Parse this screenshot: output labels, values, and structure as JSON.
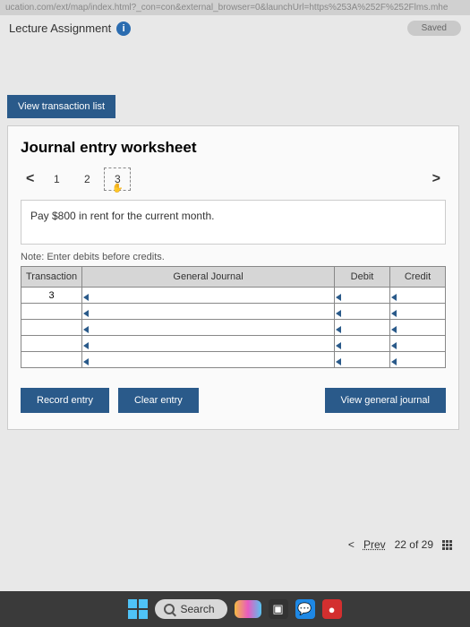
{
  "url": "ucation.com/ext/map/index.html?_con=con&external_browser=0&launchUrl=https%253A%252F%252Flms.mhe",
  "header": {
    "title": "Lecture Assignment",
    "saved_label": "Saved"
  },
  "view_transaction_btn": "View transaction list",
  "worksheet": {
    "title": "Journal entry worksheet",
    "pages": [
      "1",
      "2",
      "3"
    ],
    "current_page_index": 2,
    "instruction": "Pay $800 in rent for the current month.",
    "note": "Note: Enter debits before credits.",
    "columns": {
      "transaction": "Transaction",
      "general_journal": "General Journal",
      "debit": "Debit",
      "credit": "Credit"
    },
    "rows": [
      {
        "transaction": "3",
        "gj": "",
        "debit": "",
        "credit": ""
      },
      {
        "transaction": "",
        "gj": "",
        "debit": "",
        "credit": ""
      },
      {
        "transaction": "",
        "gj": "",
        "debit": "",
        "credit": ""
      },
      {
        "transaction": "",
        "gj": "",
        "debit": "",
        "credit": ""
      },
      {
        "transaction": "",
        "gj": "",
        "debit": "",
        "credit": ""
      }
    ],
    "buttons": {
      "record": "Record entry",
      "clear": "Clear entry",
      "view_journal": "View general journal"
    }
  },
  "footer": {
    "prev_label": "Prev",
    "position": "22 of 29"
  },
  "taskbar": {
    "search_label": "Search"
  }
}
